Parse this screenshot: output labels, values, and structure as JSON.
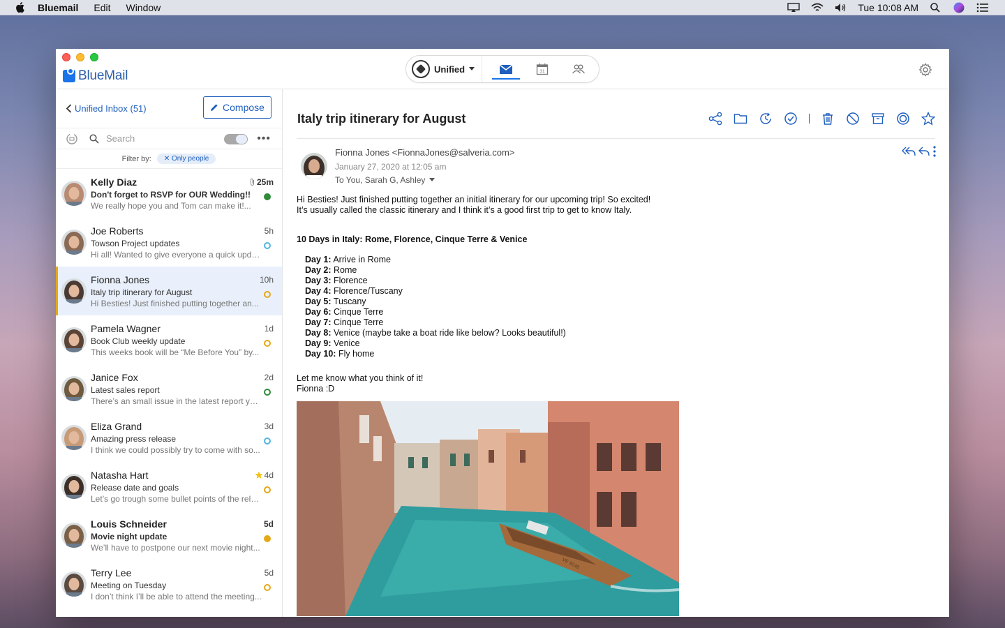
{
  "menubar": {
    "app": "Bluemail",
    "menus": [
      "Edit",
      "Window"
    ],
    "clock": "Tue 10:08 AM"
  },
  "window": {
    "brand": "BlueMail",
    "account_selector": "Unified",
    "tabs": [
      "mail-icon",
      "calendar-icon",
      "people-icon"
    ],
    "active_tab": 0,
    "calendar_day": "31"
  },
  "sidebar": {
    "back_label": "Unified Inbox (51)",
    "compose_label": "Compose",
    "search_placeholder": "Search",
    "filter_label": "Filter by:",
    "filter_chip": "Only people"
  },
  "mails": [
    {
      "from": "Kelly Diaz",
      "subject": "Don't forget to RSVP for OUR Wedding!!",
      "preview": "We really hope you and Tom can make it!...",
      "time": "25m",
      "bold": true,
      "dot": "filled-green",
      "attachment": true,
      "avatar_color": "#b98a72"
    },
    {
      "from": "Joe Roberts",
      "subject": "Towson Project updates",
      "preview": "Hi all! Wanted to give everyone a quick update...",
      "time": "5h",
      "bold": false,
      "dot": "ring-blue",
      "avatar_color": "#8a6a55"
    },
    {
      "from": "Fionna Jones",
      "subject": "Italy trip itinerary for August",
      "preview": "Hi Besties! Just finished putting together an...",
      "time": "10h",
      "bold": false,
      "dot": "ring-yellow",
      "selected": true,
      "avatar_color": "#4a3a33"
    },
    {
      "from": "Pamela Wagner",
      "subject": "Book Club weekly update",
      "preview": "This weeks book will be “Me Before You” by...",
      "time": "1d",
      "bold": false,
      "dot": "ring-yellow",
      "avatar_color": "#5b4436"
    },
    {
      "from": "Janice Fox",
      "subject": "Latest sales report",
      "preview": "There’s an small issue in the latest report you...",
      "time": "2d",
      "bold": false,
      "dot": "ring-green",
      "avatar_color": "#6e5a3f"
    },
    {
      "from": "Eliza Grand",
      "subject": "Amazing press release",
      "preview": "I think we could possibly try to come with so...",
      "time": "3d",
      "bold": false,
      "dot": "ring-blue",
      "avatar_color": "#c79a78"
    },
    {
      "from": "Natasha Hart",
      "subject": "Release date and goals",
      "preview": "Let’s go trough some bullet points of the rele...",
      "time": "4d",
      "bold": false,
      "dot": "ring-yellow",
      "star": true,
      "avatar_color": "#3d2e28"
    },
    {
      "from": "Louis Schneider",
      "subject": "Movie night update",
      "preview": "We’ll have to postpone our next movie night...",
      "time": "5d",
      "bold": true,
      "dot": "filled-yellow",
      "avatar_color": "#7a6046"
    },
    {
      "from": "Terry Lee",
      "subject": "Meeting on Tuesday",
      "preview": "I don’t think I’ll be able to attend the meeting...",
      "time": "5d",
      "bold": false,
      "dot": "ring-yellow",
      "avatar_color": "#5a4a40"
    }
  ],
  "reader": {
    "title": "Italy trip itinerary for August",
    "sender_line": "Fionna Jones <FionnaJones@salveria.com>",
    "date": "January 27, 2020 at 12:05 am",
    "to": "To You, Sarah G, Ashley",
    "intro1": "Hi Besties! Just finished putting together an initial itinerary for our upcoming trip! So excited!",
    "intro2": "It’s usually called the classic itinerary and I think it’s a good first trip to get to know Italy.",
    "heading": "10 Days in Italy: Rome, Florence, Cinque Terre & Venice",
    "days": [
      {
        "label": "Day 1:",
        "text": " Arrive in Rome"
      },
      {
        "label": "Day 2:",
        "text": " Rome"
      },
      {
        "label": "Day 3:",
        "text": " Florence"
      },
      {
        "label": "Day 4:",
        "text": " Florence/Tuscany"
      },
      {
        "label": "Day 5:",
        "text": " Tuscany"
      },
      {
        "label": "Day 6:",
        "text": " Cinque Terre"
      },
      {
        "label": "Day 7:",
        "text": " Cinque Terre"
      },
      {
        "label": "Day 8:",
        "text": " Venice (maybe take a boat ride like below? Looks beautiful!)"
      },
      {
        "label": "Day 9:",
        "text": " Venice"
      },
      {
        "label": "Day 10:",
        "text": " Fly home"
      }
    ],
    "closing1": "Let me know what you think of it!",
    "closing2": "Fionna :D",
    "toolbar_icons": [
      "share-icon",
      "folder-icon",
      "snooze-icon",
      "done-icon",
      "trash-icon",
      "spam-icon",
      "archive-icon",
      "mark-icon",
      "star-icon"
    ],
    "boat_text": "VE 9246"
  },
  "colors": {
    "accent": "#1f5fbf",
    "selected_row": "#e9f0fb",
    "selected_bar": "#e6a817"
  }
}
